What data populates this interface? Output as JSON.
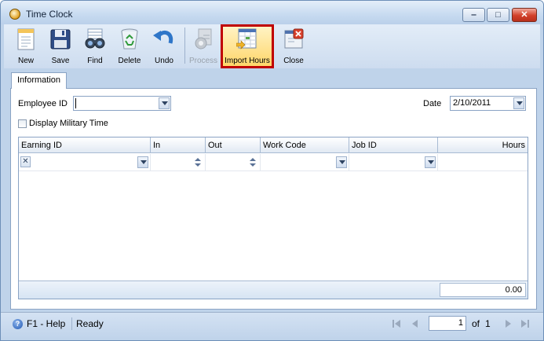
{
  "window": {
    "title": "Time Clock",
    "controls": {
      "minimize": "‒",
      "maximize": "□",
      "close": "✕"
    }
  },
  "toolbar": {
    "new": "New",
    "save": "Save",
    "find": "Find",
    "delete": "Delete",
    "undo": "Undo",
    "process": "Process",
    "import_hours": "Import Hours",
    "close": "Close"
  },
  "tabs": {
    "information": "Information"
  },
  "form": {
    "employee_id_label": "Employee ID",
    "employee_id_value": "",
    "date_label": "Date",
    "date_value": "2/10/2011",
    "military_time_label": "Display Military Time",
    "military_time_checked": false
  },
  "grid": {
    "columns": [
      "Earning ID",
      "In",
      "Out",
      "Work Code",
      "Job ID",
      "Hours"
    ],
    "remove_glyph": "✕",
    "total_hours": "0.00"
  },
  "status": {
    "help": "F1 - Help",
    "state": "Ready",
    "page": "1",
    "of_label": "of",
    "page_count": "1"
  },
  "colors": {
    "highlight_border": "#c00000",
    "window_frame": "#bfd3ea"
  }
}
